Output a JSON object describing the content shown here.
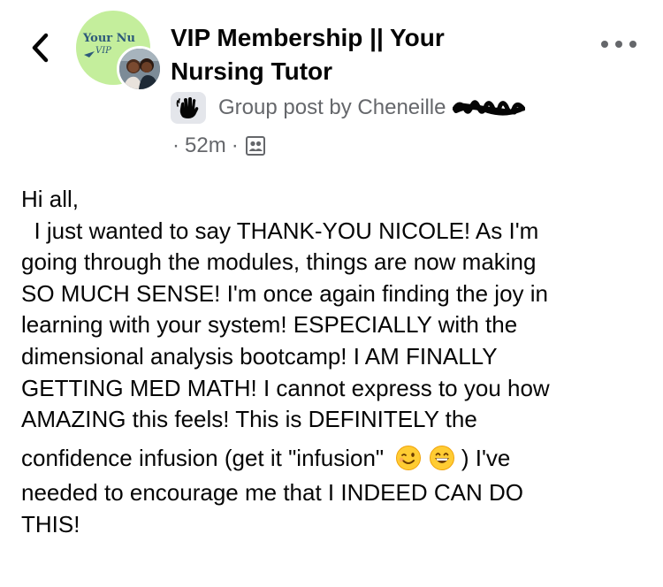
{
  "header": {
    "back_icon": "chevron-left-icon",
    "group_avatar_text": "Your Nu",
    "group_avatar_subtext": "VIP",
    "title": "VIP Membership || Your Nursing Tutor",
    "more_icon": "more-horizontal-icon"
  },
  "byline": {
    "badge_icon": "waving-hand-icon",
    "text": "Group post by Cheneille"
  },
  "meta": {
    "dot": "·",
    "time": "52m",
    "audience_icon": "members-icon"
  },
  "post": {
    "lines": [
      "Hi all,",
      "  I just wanted to say THANK-YOU NICOLE! As I'm",
      "going through the modules, things are now making",
      "SO MUCH SENSE! I'm once again finding the joy in",
      "learning with your system! ESPECIALLY with the",
      "dimensional analysis bootcamp! I AM FINALLY",
      "GETTING MED MATH! I cannot express to you how",
      "AMAZING this feels! This is DEFINITELY the",
      "confidence infusion (get it \"infusion\"",
      ") I've",
      "needed to encourage me that I INDEED CAN DO",
      "THIS!"
    ],
    "emojis": [
      "winking-face-emoji",
      "grinning-face-emoji"
    ]
  },
  "colors": {
    "text": "#050505",
    "secondary": "#65676b",
    "badge_bg": "#e4e6eb",
    "group_avatar_bg": "#c4ee9c",
    "emoji_yellow": "#ffcc33"
  }
}
